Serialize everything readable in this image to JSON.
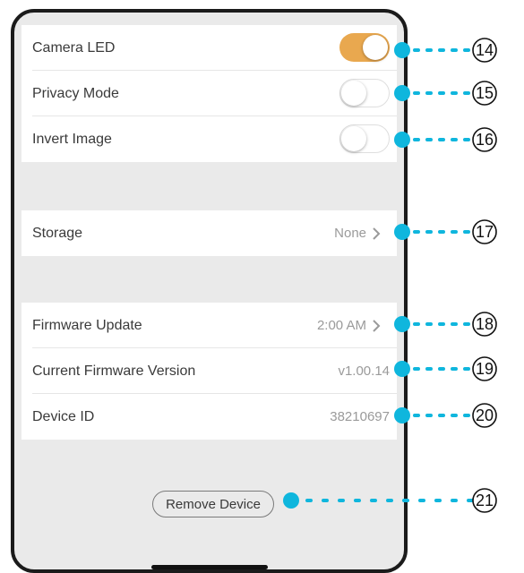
{
  "settings": {
    "camera_led": {
      "label": "Camera LED",
      "on": true
    },
    "privacy_mode": {
      "label": "Privacy Mode",
      "on": false
    },
    "invert_image": {
      "label": "Invert Image",
      "on": false
    }
  },
  "storage": {
    "label": "Storage",
    "value": "None"
  },
  "firmware": {
    "update_label": "Firmware Update",
    "update_value": "2:00 AM",
    "version_label": "Current Firmware Version",
    "version_value": "v1.00.14"
  },
  "device": {
    "id_label": "Device ID",
    "id_value": "38210697"
  },
  "remove_button": "Remove Device",
  "callouts": [
    "14",
    "15",
    "16",
    "17",
    "18",
    "19",
    "20",
    "21"
  ],
  "colors": {
    "accent": "#e9a84f",
    "callout": "#0fb6dd",
    "background": "#eaeaea"
  },
  "icons": {
    "chevron": "chevron-right-icon"
  }
}
